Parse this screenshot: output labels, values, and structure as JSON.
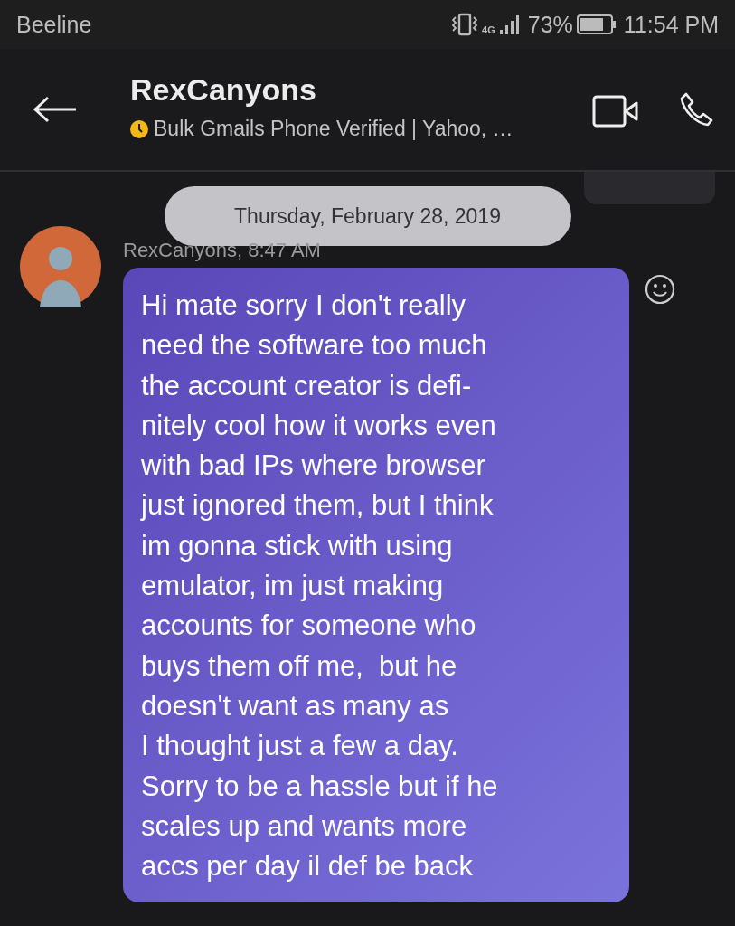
{
  "status_bar": {
    "carrier": "Beeline",
    "network": "4G",
    "battery": "73%",
    "time": "11:54 PM"
  },
  "header": {
    "title": "RexCanyons",
    "subtitle": "Bulk Gmails Phone Verified | Yahoo, …",
    "status_icon": {
      "color": "#f5b716"
    }
  },
  "date_separator": "Thursday, February 28, 2019",
  "messages": [
    {
      "kind": "outgoing_partial"
    },
    {
      "kind": "incoming",
      "sender": "RexCanyons, 8:47 AM",
      "text": "Hi mate sorry I don't really\nneed the software too much\nthe account creator is defi-\nnitely cool how it works even\nwith bad IPs where browser\njust ignored them, but I think\nim gonna stick with using\nemulator, im just making\naccounts for someone who\nbuys them off me,  but he\ndoesn't want as many as\nI thought just a few a day.\nSorry to be a hassle but if he\nscales up and wants more\naccs per day il def be back"
    }
  ]
}
